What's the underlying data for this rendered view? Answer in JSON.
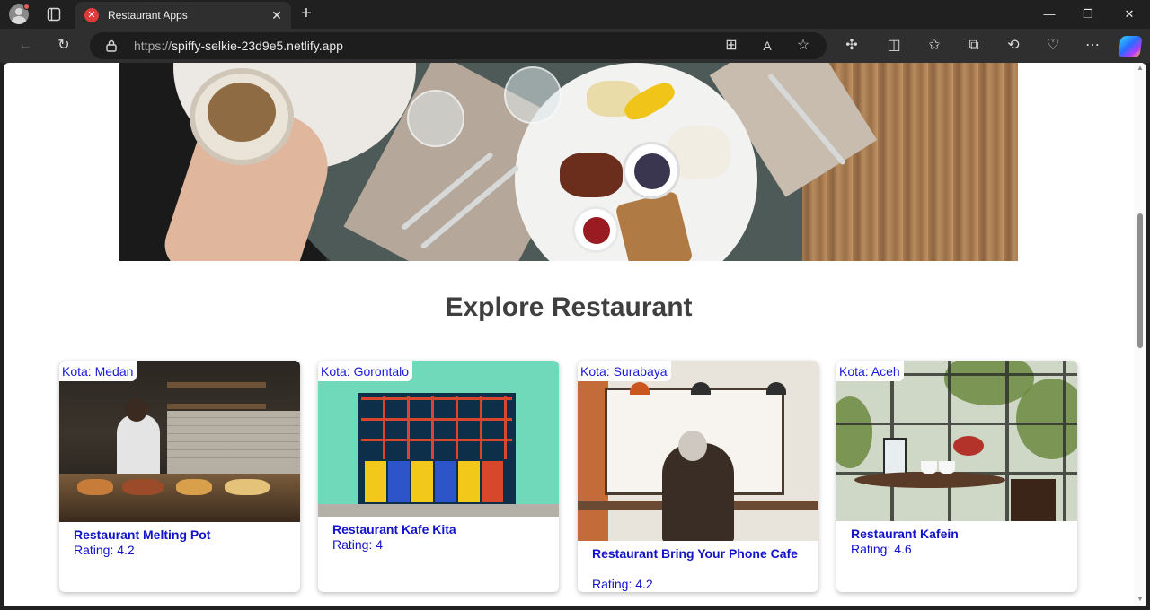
{
  "browser": {
    "tab_title": "Restaurant Apps",
    "url_protocol": "https://",
    "url_host": "spiffy-selkie-23d9e5.netlify.app"
  },
  "page": {
    "section_title": "Explore Restaurant"
  },
  "restaurants": [
    {
      "city": "Kota: Medan",
      "name": "Restaurant Melting Pot",
      "rating": "Rating: 4.2"
    },
    {
      "city": "Kota: Gorontalo",
      "name": "Restaurant Kafe Kita",
      "rating": "Rating: 4"
    },
    {
      "city": "Kota: Surabaya",
      "name": "Restaurant Bring Your Phone Cafe",
      "rating": "Rating: 4.2"
    },
    {
      "city": "Kota: Aceh",
      "name": "Restaurant Kafein",
      "rating": "Rating: 4.6"
    }
  ],
  "colors": {
    "link_blue": "#1212c9",
    "heading_gray": "#3f3f3f"
  }
}
